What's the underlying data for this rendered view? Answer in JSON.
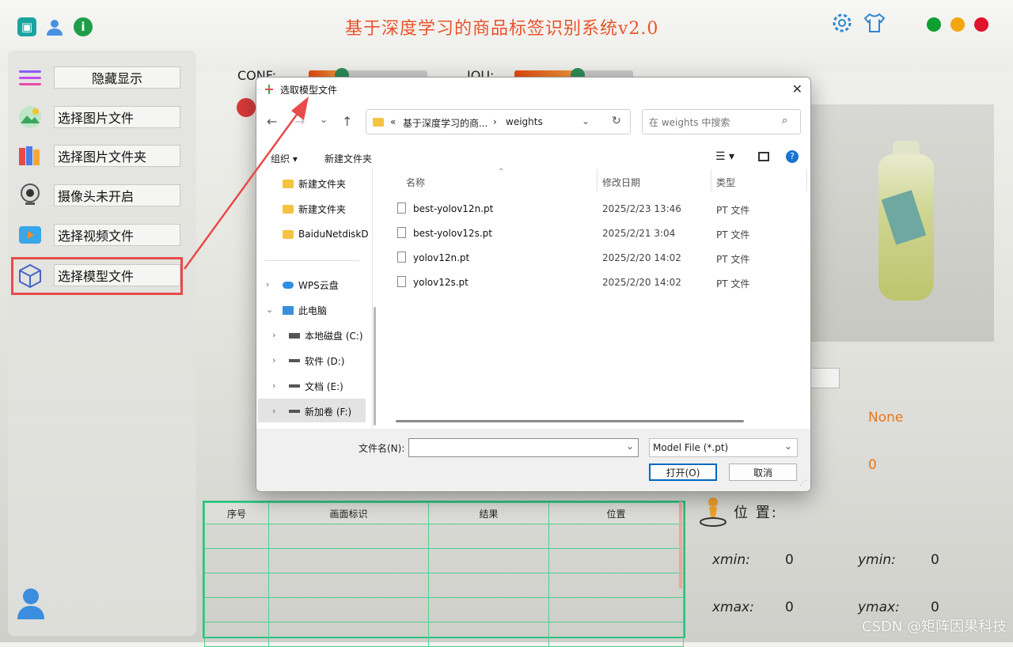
{
  "app": {
    "title": "基于深度学习的商品标签识别系统v2.0",
    "window_dots": [
      "#0e9e31",
      "#f2a70f",
      "#e0142b"
    ],
    "sidebar": {
      "toggle_label": "隐藏显示",
      "items": [
        {
          "label": "选择图片文件",
          "icon": "image-icon"
        },
        {
          "label": "选择图片文件夹",
          "icon": "books-icon"
        },
        {
          "label": "摄像头未开启",
          "icon": "webcam-icon"
        },
        {
          "label": "选择视频文件",
          "icon": "video-icon"
        },
        {
          "label": "选择模型文件",
          "icon": "model-icon"
        }
      ]
    },
    "sliders": {
      "conf_label": "CONF:",
      "iou_label": "IOU:"
    },
    "table": {
      "headers": [
        "序号",
        "画面标识",
        "结果",
        "位置"
      ]
    },
    "results": {
      "none_text": "None",
      "zero_text": "0",
      "position_label": "位 置:",
      "xmin_label": "xmin:",
      "xmin": "0",
      "ymin_label": "ymin:",
      "ymin": "0",
      "xmax_label": "xmax:",
      "xmax": "0",
      "ymax_label": "ymax:",
      "ymax": "0"
    },
    "watermark": "CSDN @矩阵因果科技"
  },
  "dialog": {
    "title": "选取模型文件",
    "close": "✕",
    "breadcrumb_prefix": "«",
    "breadcrumb_parent": "基于深度学习的商...",
    "breadcrumb_sep": "›",
    "breadcrumb_current": "weights",
    "search_placeholder": "在 weights 中搜索",
    "toolbar": {
      "organize": "组织 ▾",
      "new_folder": "新建文件夹"
    },
    "tree": [
      {
        "label": "新建文件夹",
        "kind": "folder"
      },
      {
        "label": "新建文件夹",
        "kind": "folder"
      },
      {
        "label": "BaiduNetdiskD",
        "kind": "folder"
      },
      {
        "label": "WPS云盘",
        "kind": "cloud"
      },
      {
        "label": "此电脑",
        "kind": "pc"
      },
      {
        "label": "本地磁盘 (C:)",
        "kind": "drive"
      },
      {
        "label": "软件 (D:)",
        "kind": "drive"
      },
      {
        "label": "文档 (E:)",
        "kind": "drive"
      },
      {
        "label": "新加卷 (F:)",
        "kind": "drive"
      }
    ],
    "columns": {
      "name": "名称",
      "date": "修改日期",
      "type": "类型"
    },
    "files": [
      {
        "name": "best-yolov12n.pt",
        "date": "2025/2/23 13:46",
        "type": "PT 文件"
      },
      {
        "name": "best-yolov12s.pt",
        "date": "2025/2/21 3:04",
        "type": "PT 文件"
      },
      {
        "name": "yolov12n.pt",
        "date": "2025/2/20 14:02",
        "type": "PT 文件"
      },
      {
        "name": "yolov12s.pt",
        "date": "2025/2/20 14:02",
        "type": "PT 文件"
      }
    ],
    "filename_label": "文件名(N):",
    "filename_value": "",
    "filetype": "Model File (*.pt)",
    "open_button": "打开(O)",
    "cancel_button": "取消"
  },
  "colors": {
    "title": "#e9542b",
    "highlight": "#e74b4b",
    "table_border": "#2cc27e",
    "accent_orange": "#e8771d",
    "primary_blue": "#0067c0"
  }
}
